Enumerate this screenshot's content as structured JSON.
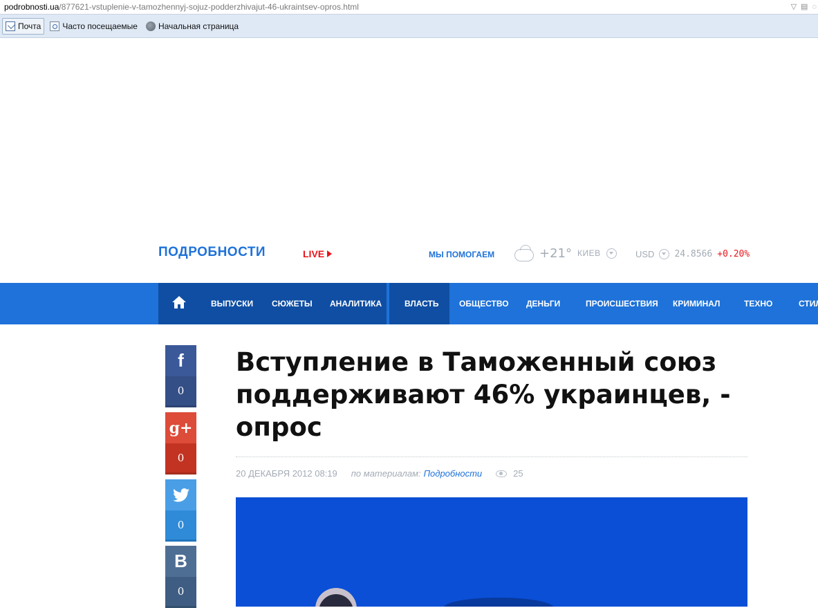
{
  "browser": {
    "url_host": "podrobnosti.ua",
    "url_path": "/877621-vstuplenie-v-tamozhennyj-sojuz-podderzhivajut-46-ukraintsev-opros.html",
    "bookmarks": [
      {
        "label": "Почта",
        "icon": "mail-icon"
      },
      {
        "label": "Часто посещаемые",
        "icon": "page-icon"
      },
      {
        "label": "Начальная страница",
        "icon": "globe-icon"
      }
    ]
  },
  "header": {
    "logo": "ПОДРОБНОСТИ",
    "live": "LIVE",
    "help": "МЫ ПОМОГАЕМ",
    "weather": {
      "temp": "+21°",
      "city": "КИЕВ"
    },
    "currency": {
      "code": "USD",
      "value": "24.8566",
      "change": "+0.20%"
    }
  },
  "nav": {
    "items": [
      "ВЫПУСКИ",
      "СЮЖЕТЫ",
      "АНАЛИТИКА",
      "ВЛАСТЬ",
      "ОБЩЕСТВО",
      "ДЕНЬГИ",
      "ПРОИСШЕСТВИЯ",
      "КРИМИНАЛ",
      "ТЕХНО",
      "СТИЛЬ"
    ],
    "active": "ВЛАСТЬ"
  },
  "share": [
    {
      "network": "facebook",
      "glyph": "f",
      "count": "0",
      "color_top": "#3b5998",
      "color_bottom": "#344e86",
      "color_bar": "#2d4373"
    },
    {
      "network": "google-plus",
      "glyph": "g+",
      "count": "0",
      "color_top": "#dd4b39",
      "color_bottom": "#c23321",
      "color_bar": "#a82e1d"
    },
    {
      "network": "twitter",
      "glyph": "t",
      "count": "0",
      "color_top": "#4a9ee6",
      "color_bottom": "#2f8ad8",
      "color_bar": "#2276c0"
    },
    {
      "network": "vkontakte",
      "glyph": "B",
      "count": "0",
      "color_top": "#4f6e94",
      "color_bottom": "#3f5d82",
      "color_bar": "#34506f"
    }
  ],
  "article": {
    "title": "Вступление в Таможенный союз поддерживают 46% украинцев, - опрос",
    "date": "20 ДЕКАБРЯ 2012 08:19",
    "source_prefix": "по материалам:",
    "source": "Подробности",
    "views": "25"
  },
  "colors": {
    "brand_blue": "#1e72d9",
    "nav_dark": "#0f4ea3",
    "live_red": "#e8141b"
  }
}
